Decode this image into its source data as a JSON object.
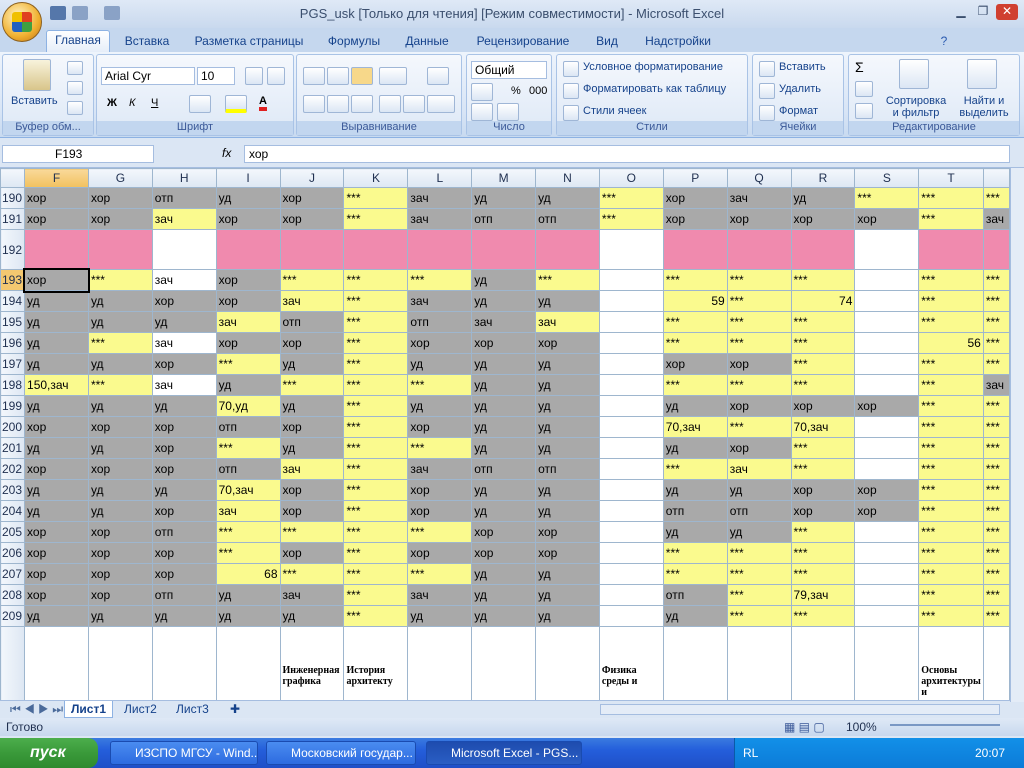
{
  "window": {
    "title": "PGS_usk  [Только для чтения]  [Режим совместимости] - Microsoft Excel"
  },
  "tabs": [
    "Главная",
    "Вставка",
    "Разметка страницы",
    "Формулы",
    "Данные",
    "Рецензирование",
    "Вид",
    "Надстройки"
  ],
  "ribbon": {
    "clipboard": {
      "label": "Буфер обм...",
      "paste": "Вставить"
    },
    "font": {
      "label": "Шрифт",
      "name": "Arial Cyr",
      "size": "10"
    },
    "alignment": {
      "label": "Выравнивание"
    },
    "number": {
      "label": "Число",
      "format": "Общий"
    },
    "styles": {
      "label": "Стили",
      "cond": "Условное форматирование",
      "table": "Форматировать как таблицу",
      "cell": "Стили ячеек"
    },
    "cells": {
      "label": "Ячейки",
      "insert": "Вставить",
      "delete": "Удалить",
      "format": "Формат"
    },
    "editing": {
      "label": "Редактирование",
      "sort": "Сортировка и фильтр",
      "find": "Найти и выделить"
    }
  },
  "formula": {
    "name": "F193",
    "value": "хор",
    "fx": "fx"
  },
  "columns": [
    "F",
    "G",
    "H",
    "I",
    "J",
    "K",
    "L",
    "M",
    "N",
    "O",
    "P",
    "Q",
    "R",
    "S",
    "T",
    ""
  ],
  "rows": [
    {
      "n": "190",
      "c": [
        [
          "хор",
          "g"
        ],
        [
          "хор",
          "g"
        ],
        [
          "отп",
          "g"
        ],
        [
          "уд",
          "g"
        ],
        [
          "хор",
          "g"
        ],
        [
          "***",
          "y"
        ],
        [
          "зач",
          "g"
        ],
        [
          "уд",
          "g"
        ],
        [
          "уд",
          "g"
        ],
        [
          "***",
          "y"
        ],
        [
          "хор",
          "g"
        ],
        [
          "зач",
          "g"
        ],
        [
          "уд",
          "g"
        ],
        [
          "***",
          "y"
        ],
        [
          "***",
          "y"
        ],
        [
          "***",
          "y"
        ]
      ]
    },
    {
      "n": "191",
      "c": [
        [
          "хор",
          "g"
        ],
        [
          "хор",
          "g"
        ],
        [
          "зач",
          "y"
        ],
        [
          "хор",
          "g"
        ],
        [
          "хор",
          "g"
        ],
        [
          "***",
          "y"
        ],
        [
          "зач",
          "g"
        ],
        [
          "отп",
          "g"
        ],
        [
          "отп",
          "g"
        ],
        [
          "***",
          "y"
        ],
        [
          "хор",
          "g"
        ],
        [
          "хор",
          "g"
        ],
        [
          "хор",
          "g"
        ],
        [
          "хор",
          "g"
        ],
        [
          "***",
          "y"
        ],
        [
          "зач",
          "g"
        ]
      ]
    },
    {
      "n": "192",
      "c": [
        [
          "",
          "p"
        ],
        [
          "",
          "p"
        ],
        [
          "",
          "w"
        ],
        [
          "",
          "p"
        ],
        [
          "",
          "p"
        ],
        [
          "",
          "p"
        ],
        [
          "",
          "p"
        ],
        [
          "",
          "p"
        ],
        [
          "",
          "p"
        ],
        [
          "",
          "w"
        ],
        [
          "",
          "p"
        ],
        [
          "",
          "p"
        ],
        [
          "",
          "p"
        ],
        [
          "",
          "w"
        ],
        [
          "",
          "p"
        ],
        [
          "",
          "p"
        ]
      ]
    },
    {
      "n": "193",
      "c": [
        [
          "хор",
          "g"
        ],
        [
          "***",
          "y"
        ],
        [
          "зач",
          "w"
        ],
        [
          "хор",
          "g"
        ],
        [
          "***",
          "y"
        ],
        [
          "***",
          "y"
        ],
        [
          "***",
          "y"
        ],
        [
          "уд",
          "g"
        ],
        [
          "***",
          "y"
        ],
        [
          "",
          "w"
        ],
        [
          "***",
          "y"
        ],
        [
          "***",
          "y"
        ],
        [
          "***",
          "y"
        ],
        [
          "",
          "w"
        ],
        [
          "***",
          "y"
        ],
        [
          "***",
          "y"
        ]
      ]
    },
    {
      "n": "194",
      "c": [
        [
          "уд",
          "g"
        ],
        [
          "уд",
          "g"
        ],
        [
          "хор",
          "g"
        ],
        [
          "хор",
          "g"
        ],
        [
          "зач",
          "y"
        ],
        [
          "***",
          "y"
        ],
        [
          "зач",
          "g"
        ],
        [
          "уд",
          "g"
        ],
        [
          "уд",
          "g"
        ],
        [
          "",
          "w"
        ],
        [
          "59",
          "yr"
        ],
        [
          "***",
          "y"
        ],
        [
          "74",
          "yr"
        ],
        [
          "",
          "w"
        ],
        [
          "***",
          "y"
        ],
        [
          "***",
          "y"
        ]
      ]
    },
    {
      "n": "195",
      "c": [
        [
          "уд",
          "g"
        ],
        [
          "уд",
          "g"
        ],
        [
          "уд",
          "g"
        ],
        [
          "зач",
          "y"
        ],
        [
          "отп",
          "g"
        ],
        [
          "***",
          "y"
        ],
        [
          "отп",
          "g"
        ],
        [
          "зач",
          "g"
        ],
        [
          "зач",
          "y"
        ],
        [
          "",
          "w"
        ],
        [
          "***",
          "y"
        ],
        [
          "***",
          "y"
        ],
        [
          "***",
          "y"
        ],
        [
          "",
          "w"
        ],
        [
          "***",
          "y"
        ],
        [
          "***",
          "y"
        ]
      ]
    },
    {
      "n": "196",
      "c": [
        [
          "уд",
          "g"
        ],
        [
          "***",
          "y"
        ],
        [
          "зач",
          "w"
        ],
        [
          "хор",
          "g"
        ],
        [
          "хор",
          "g"
        ],
        [
          "***",
          "y"
        ],
        [
          "хор",
          "g"
        ],
        [
          "хор",
          "g"
        ],
        [
          "хор",
          "g"
        ],
        [
          "",
          "w"
        ],
        [
          "***",
          "y"
        ],
        [
          "***",
          "y"
        ],
        [
          "***",
          "y"
        ],
        [
          "",
          "w"
        ],
        [
          "56",
          "yr"
        ],
        [
          "***",
          "y"
        ]
      ]
    },
    {
      "n": "197",
      "c": [
        [
          "уд",
          "g"
        ],
        [
          "уд",
          "g"
        ],
        [
          "хор",
          "g"
        ],
        [
          "***",
          "y"
        ],
        [
          "уд",
          "g"
        ],
        [
          "***",
          "y"
        ],
        [
          "уд",
          "g"
        ],
        [
          "уд",
          "g"
        ],
        [
          "уд",
          "g"
        ],
        [
          "",
          "w"
        ],
        [
          "хор",
          "g"
        ],
        [
          "хор",
          "g"
        ],
        [
          "***",
          "y"
        ],
        [
          "",
          "w"
        ],
        [
          "***",
          "y"
        ],
        [
          "***",
          "y"
        ]
      ]
    },
    {
      "n": "198",
      "c": [
        [
          "150,зач",
          "y"
        ],
        [
          "***",
          "y"
        ],
        [
          "зач",
          "w"
        ],
        [
          "уд",
          "g"
        ],
        [
          "***",
          "y"
        ],
        [
          "***",
          "y"
        ],
        [
          "***",
          "y"
        ],
        [
          "уд",
          "g"
        ],
        [
          "уд",
          "g"
        ],
        [
          "",
          "w"
        ],
        [
          "***",
          "y"
        ],
        [
          "***",
          "y"
        ],
        [
          "***",
          "y"
        ],
        [
          "",
          "w"
        ],
        [
          "***",
          "y"
        ],
        [
          "зач",
          "g"
        ]
      ]
    },
    {
      "n": "199",
      "c": [
        [
          "уд",
          "g"
        ],
        [
          "уд",
          "g"
        ],
        [
          "уд",
          "g"
        ],
        [
          "70,уд",
          "y"
        ],
        [
          "уд",
          "g"
        ],
        [
          "***",
          "y"
        ],
        [
          "уд",
          "g"
        ],
        [
          "уд",
          "g"
        ],
        [
          "уд",
          "g"
        ],
        [
          "",
          "w"
        ],
        [
          "уд",
          "g"
        ],
        [
          "хор",
          "g"
        ],
        [
          "хор",
          "g"
        ],
        [
          "хор",
          "g"
        ],
        [
          "***",
          "y"
        ],
        [
          "***",
          "y"
        ]
      ]
    },
    {
      "n": "200",
      "c": [
        [
          "хор",
          "g"
        ],
        [
          "хор",
          "g"
        ],
        [
          "хор",
          "g"
        ],
        [
          "отп",
          "g"
        ],
        [
          "хор",
          "g"
        ],
        [
          "***",
          "y"
        ],
        [
          "хор",
          "g"
        ],
        [
          "уд",
          "g"
        ],
        [
          "уд",
          "g"
        ],
        [
          "",
          "w"
        ],
        [
          "70,зач",
          "y"
        ],
        [
          "***",
          "y"
        ],
        [
          "70,зач",
          "y"
        ],
        [
          "",
          "w"
        ],
        [
          "***",
          "y"
        ],
        [
          "***",
          "y"
        ]
      ]
    },
    {
      "n": "201",
      "c": [
        [
          "уд",
          "g"
        ],
        [
          "уд",
          "g"
        ],
        [
          "хор",
          "g"
        ],
        [
          "***",
          "y"
        ],
        [
          "уд",
          "g"
        ],
        [
          "***",
          "y"
        ],
        [
          "***",
          "y"
        ],
        [
          "уд",
          "g"
        ],
        [
          "уд",
          "g"
        ],
        [
          "",
          "w"
        ],
        [
          "уд",
          "g"
        ],
        [
          "хор",
          "g"
        ],
        [
          "***",
          "y"
        ],
        [
          "",
          "w"
        ],
        [
          "***",
          "y"
        ],
        [
          "***",
          "y"
        ]
      ]
    },
    {
      "n": "202",
      "c": [
        [
          "хор",
          "g"
        ],
        [
          "хор",
          "g"
        ],
        [
          "хор",
          "g"
        ],
        [
          "отп",
          "g"
        ],
        [
          "зач",
          "y"
        ],
        [
          "***",
          "y"
        ],
        [
          "зач",
          "g"
        ],
        [
          "отп",
          "g"
        ],
        [
          "отп",
          "g"
        ],
        [
          "",
          "w"
        ],
        [
          "***",
          "y"
        ],
        [
          "зач",
          "y"
        ],
        [
          "***",
          "y"
        ],
        [
          "",
          "w"
        ],
        [
          "***",
          "y"
        ],
        [
          "***",
          "y"
        ]
      ]
    },
    {
      "n": "203",
      "c": [
        [
          "уд",
          "g"
        ],
        [
          "уд",
          "g"
        ],
        [
          "уд",
          "g"
        ],
        [
          "70,зач",
          "y"
        ],
        [
          "хор",
          "g"
        ],
        [
          "***",
          "y"
        ],
        [
          "хор",
          "g"
        ],
        [
          "уд",
          "g"
        ],
        [
          "уд",
          "g"
        ],
        [
          "",
          "w"
        ],
        [
          "уд",
          "g"
        ],
        [
          "уд",
          "g"
        ],
        [
          "хор",
          "g"
        ],
        [
          "хор",
          "g"
        ],
        [
          "***",
          "y"
        ],
        [
          "***",
          "y"
        ]
      ]
    },
    {
      "n": "204",
      "c": [
        [
          "уд",
          "g"
        ],
        [
          "уд",
          "g"
        ],
        [
          "хор",
          "g"
        ],
        [
          "зач",
          "y"
        ],
        [
          "хор",
          "g"
        ],
        [
          "***",
          "y"
        ],
        [
          "хор",
          "g"
        ],
        [
          "уд",
          "g"
        ],
        [
          "уд",
          "g"
        ],
        [
          "",
          "w"
        ],
        [
          "отп",
          "g"
        ],
        [
          "отп",
          "g"
        ],
        [
          "хор",
          "g"
        ],
        [
          "хор",
          "g"
        ],
        [
          "***",
          "y"
        ],
        [
          "***",
          "y"
        ]
      ]
    },
    {
      "n": "205",
      "c": [
        [
          "хор",
          "g"
        ],
        [
          "хор",
          "g"
        ],
        [
          "отп",
          "g"
        ],
        [
          "***",
          "y"
        ],
        [
          "***",
          "y"
        ],
        [
          "***",
          "y"
        ],
        [
          "***",
          "y"
        ],
        [
          "хор",
          "g"
        ],
        [
          "хор",
          "g"
        ],
        [
          "",
          "w"
        ],
        [
          "уд",
          "g"
        ],
        [
          "уд",
          "g"
        ],
        [
          "***",
          "y"
        ],
        [
          "",
          "w"
        ],
        [
          "***",
          "y"
        ],
        [
          "***",
          "y"
        ]
      ]
    },
    {
      "n": "206",
      "c": [
        [
          "хор",
          "g"
        ],
        [
          "хор",
          "g"
        ],
        [
          "хор",
          "g"
        ],
        [
          "***",
          "y"
        ],
        [
          "хор",
          "g"
        ],
        [
          "***",
          "y"
        ],
        [
          "хор",
          "g"
        ],
        [
          "хор",
          "g"
        ],
        [
          "хор",
          "g"
        ],
        [
          "",
          "w"
        ],
        [
          "***",
          "y"
        ],
        [
          "***",
          "y"
        ],
        [
          "***",
          "y"
        ],
        [
          "",
          "w"
        ],
        [
          "***",
          "y"
        ],
        [
          "***",
          "y"
        ]
      ]
    },
    {
      "n": "207",
      "c": [
        [
          "хор",
          "g"
        ],
        [
          "хор",
          "g"
        ],
        [
          "хор",
          "g"
        ],
        [
          "68",
          "yr"
        ],
        [
          "***",
          "y"
        ],
        [
          "***",
          "y"
        ],
        [
          "***",
          "y"
        ],
        [
          "уд",
          "g"
        ],
        [
          "уд",
          "g"
        ],
        [
          "",
          "w"
        ],
        [
          "***",
          "y"
        ],
        [
          "***",
          "y"
        ],
        [
          "***",
          "y"
        ],
        [
          "",
          "w"
        ],
        [
          "***",
          "y"
        ],
        [
          "***",
          "y"
        ]
      ]
    },
    {
      "n": "208",
      "c": [
        [
          "хор",
          "g"
        ],
        [
          "хор",
          "g"
        ],
        [
          "отп",
          "g"
        ],
        [
          "уд",
          "g"
        ],
        [
          "зач",
          "g"
        ],
        [
          "***",
          "y"
        ],
        [
          "зач",
          "g"
        ],
        [
          "уд",
          "g"
        ],
        [
          "уд",
          "g"
        ],
        [
          "",
          "w"
        ],
        [
          "отп",
          "g"
        ],
        [
          "***",
          "y"
        ],
        [
          "79,зач",
          "y"
        ],
        [
          "",
          "w"
        ],
        [
          "***",
          "y"
        ],
        [
          "***",
          "y"
        ]
      ]
    },
    {
      "n": "209",
      "c": [
        [
          "уд",
          "g"
        ],
        [
          "уд",
          "g"
        ],
        [
          "уд",
          "g"
        ],
        [
          "уд",
          "g"
        ],
        [
          "уд",
          "g"
        ],
        [
          "***",
          "y"
        ],
        [
          "уд",
          "g"
        ],
        [
          "уд",
          "g"
        ],
        [
          "уд",
          "g"
        ],
        [
          "",
          "w"
        ],
        [
          "уд",
          "g"
        ],
        [
          "***",
          "y"
        ],
        [
          "***",
          "y"
        ],
        [
          "",
          "w"
        ],
        [
          "***",
          "y"
        ],
        [
          "***",
          "y"
        ]
      ]
    }
  ],
  "footer_row": {
    "J": "Инженерная графика",
    "K": "История архитекту",
    "O": "Физика среды и",
    "T": "Основы архитектуры и"
  },
  "sheets": [
    "Лист1",
    "Лист2",
    "Лист3"
  ],
  "status": {
    "ready": "Готово",
    "zoom": "100%"
  },
  "taskbar": {
    "start": "пуск",
    "items": [
      "ИЗСПО МГСУ - Wind...",
      "Московский государ...",
      "Microsoft Excel - PGS..."
    ],
    "lang": "RL",
    "time": "20:07"
  }
}
